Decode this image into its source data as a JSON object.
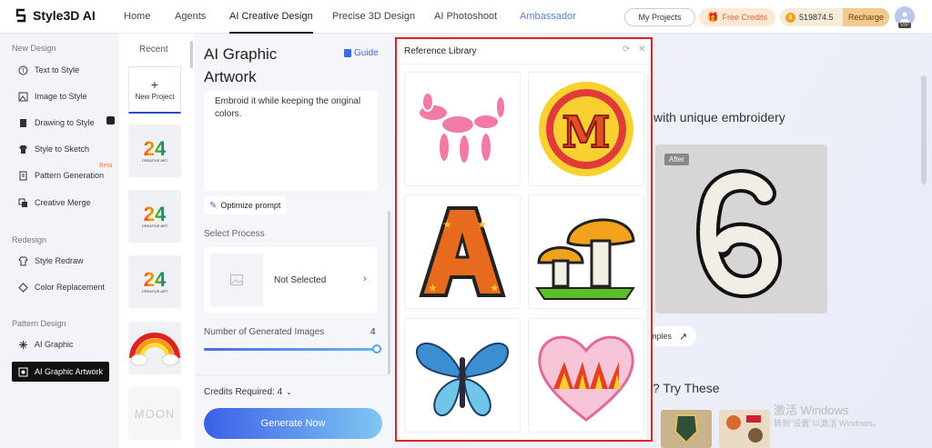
{
  "brand": {
    "name": "Style3D AI"
  },
  "nav": {
    "home": "Home",
    "agents": "Agents",
    "creative": "AI Creative Design",
    "precise": "Precise 3D Design",
    "photoshoot": "AI Photoshoot",
    "ambassador": "Ambassador"
  },
  "header": {
    "my_projects": "My Projects",
    "free_credits": "Free Credits",
    "credits": "519874.5",
    "recharge": "Recharge",
    "vip": "VIP"
  },
  "sidebar": {
    "section_new": "New Design",
    "section_redesign": "Redesign",
    "section_pattern": "Pattern Design",
    "items": [
      {
        "label": "Text to Style",
        "icon": "text-style-icon"
      },
      {
        "label": "Image to Style",
        "icon": "image-style-icon"
      },
      {
        "label": "Drawing to Style",
        "icon": "drawing-style-icon"
      },
      {
        "label": "Style to Sketch",
        "icon": "sketch-icon"
      },
      {
        "label": "Pattern Generation",
        "icon": "pattern-icon",
        "badge": "Beta"
      },
      {
        "label": "Creative Merge",
        "icon": "merge-icon"
      },
      {
        "label": "Style Redraw",
        "icon": "redraw-icon"
      },
      {
        "label": "Color Replacement",
        "icon": "color-icon"
      },
      {
        "label": "AI Graphic",
        "icon": "graphic-icon"
      },
      {
        "label": "AI Graphic Artwork",
        "icon": "artwork-icon"
      }
    ]
  },
  "recent": {
    "title": "Recent",
    "new_project": "New Project",
    "thumb_text": "24",
    "thumb_sub": "CREATIVE ART",
    "moon": "MOON"
  },
  "panel": {
    "title": "AI Graphic Artwork",
    "guide": "Guide",
    "prompt": "Embroid it while keeping the original colors.",
    "optimize": "Optimize prompt",
    "select_process": "Select Process",
    "not_selected": "Not Selected",
    "num_images_label": "Number of Generated Images",
    "num_images": "4",
    "num_images_fraction": 1.0,
    "credits_required": "Credits Required: 4",
    "generate": "Generate Now"
  },
  "main": {
    "headline": "with unique embroidery",
    "after_badge": "After",
    "examples": "mples",
    "try_these": "al? Try These"
  },
  "library": {
    "title": "Reference Library",
    "items": [
      "balloon-dog-patch",
      "letter-m-patch",
      "letter-a-patch",
      "mushroom-patch",
      "butterfly-patch",
      "heart-beaded-patch"
    ]
  },
  "watermark": {
    "line1": "激活 Windows",
    "line2": "转到\"设置\"以激活 Windows。"
  }
}
